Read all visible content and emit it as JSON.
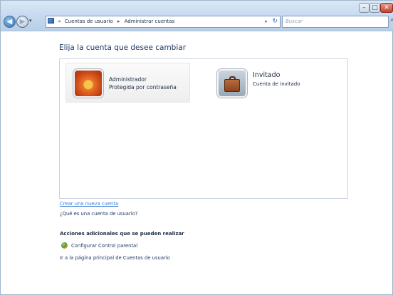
{
  "window": {
    "title": "",
    "controls": {
      "minimize": "–",
      "maximize": "□",
      "close": "✕"
    }
  },
  "nav": {
    "back_icon": "back-arrow-icon",
    "forward_icon": "forward-arrow-icon",
    "history_dropdown": "▾"
  },
  "address_bar": {
    "prefix": "«",
    "crumbs": [
      "Cuentas de usuario",
      "Administrar cuentas"
    ],
    "separator": "▸",
    "dropdown": "▾",
    "refresh": "↻"
  },
  "search": {
    "placeholder": "Buscar",
    "icon": "search-icon"
  },
  "main": {
    "heading": "Elija la cuenta que desee cambiar",
    "accounts": [
      {
        "name": "Administrador",
        "subtitle": "Protegida por contraseña",
        "icon": "flower-avatar-icon"
      },
      {
        "name": "Invitado",
        "subtitle": "Cuenta de invitado",
        "icon": "suitcase-avatar-icon"
      }
    ],
    "links": {
      "create": "Crear una nueva cuenta",
      "what_is": "¿Qué es una cuenta de usuario?"
    },
    "additional": {
      "title": "Acciones adicionales que se pueden realizar",
      "parental": "Configurar Control parental",
      "home": "Ir a la página principal de Cuentas de usuario"
    }
  },
  "colors": {
    "heading": "#1e3a63",
    "link": "#3a7bd5",
    "titlebar": "#c4d8ee"
  }
}
